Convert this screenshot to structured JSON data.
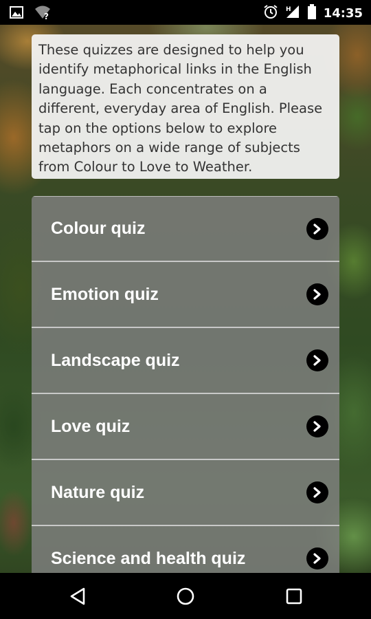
{
  "status_bar": {
    "time": "14:35",
    "icons": [
      "image-icon",
      "wifi-unknown-icon",
      "alarm-icon",
      "signal-icon",
      "battery-icon"
    ]
  },
  "intro": {
    "text": "These quizzes are designed to help you identify metaphorical links in the English language. Each concentrates on a different, everyday area of English. Please tap on the options below to explore metaphors on a wide range of subjects from Colour to Love to Weather."
  },
  "quizzes": [
    {
      "label": "Colour quiz"
    },
    {
      "label": "Emotion quiz"
    },
    {
      "label": "Landscape quiz"
    },
    {
      "label": "Love quiz"
    },
    {
      "label": "Nature quiz"
    },
    {
      "label": "Science and health quiz"
    }
  ],
  "nav_bar": {
    "icons": [
      "back-icon",
      "home-icon",
      "recents-icon"
    ]
  },
  "colors": {
    "status_bar": "#000000",
    "card_bg": "#f5f5f5",
    "list_item_bg": "#808080",
    "chevron_bg": "#000000",
    "text_on_list": "#ffffff"
  }
}
